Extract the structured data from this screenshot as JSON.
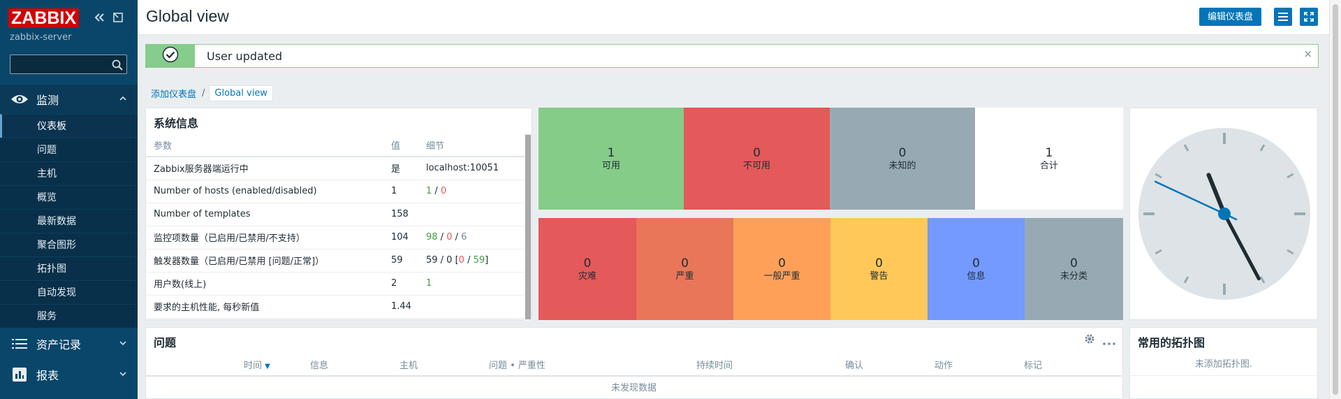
{
  "sidebar": {
    "logo": "ZABBIX",
    "server": "zabbix-server",
    "search_value": "",
    "sections": [
      {
        "label": "监测",
        "icon": "eye-icon",
        "chevron": "^"
      },
      {
        "label": "资产记录",
        "icon": "list-icon",
        "chevron": "v"
      },
      {
        "label": "报表",
        "icon": "chart-icon",
        "chevron": "v"
      }
    ],
    "monitoring_items": [
      {
        "label": "仪表板"
      },
      {
        "label": "问题"
      },
      {
        "label": "主机"
      },
      {
        "label": "概览"
      },
      {
        "label": "最新数据"
      },
      {
        "label": "聚合图形"
      },
      {
        "label": "拓扑图"
      },
      {
        "label": "自动发现"
      },
      {
        "label": "服务"
      }
    ]
  },
  "header": {
    "title": "Global view",
    "edit_label": "编辑仪表盘"
  },
  "message": {
    "text": "User updated",
    "close": "×"
  },
  "breadcrumb": {
    "link": "添加仪表盘",
    "separator": "/",
    "current": "Global view"
  },
  "system_info": {
    "title": "系统信息",
    "headers": {
      "param": "参数",
      "value": "值",
      "details": "细节"
    },
    "rows": [
      {
        "param": "Zabbix服务器端运行中",
        "value": "是",
        "d1": "localhost:10051",
        "d2": "",
        "d3": "",
        "d4": "",
        "d5": "",
        "d6": "",
        "d7": ""
      },
      {
        "param": "Number of hosts (enabled/disabled)",
        "value": "1",
        "d1": "",
        "d2": "1",
        "d3": " / ",
        "d4": "0",
        "d5": "",
        "d6": "",
        "d7": ""
      },
      {
        "param": "Number of templates",
        "value": "158",
        "d1": "",
        "d2": "",
        "d3": "",
        "d4": "",
        "d5": "",
        "d6": "",
        "d7": ""
      },
      {
        "param": "监控项数量（已启用/已禁用/不支持）",
        "value": "104",
        "d1": "",
        "d2": "98",
        "d3": " / ",
        "d4": "0",
        "d5": " / ",
        "d6": "6",
        "d7": ""
      },
      {
        "param": "触发器数量（已启用/已禁用 [问题/正常]）",
        "value": "59",
        "d1": "59 / 0 [",
        "d2": "",
        "d3": "",
        "d4": "0",
        "d5": " / ",
        "d6": "59",
        "d7": "]"
      },
      {
        "param": "用户数(线上)",
        "value": "2",
        "d1": "",
        "d2": "1",
        "d3": "",
        "d4": "",
        "d5": "",
        "d6": "",
        "d7": ""
      },
      {
        "param": "要求的主机性能, 每秒新值",
        "value": "1.44",
        "d1": "",
        "d2": "",
        "d3": "",
        "d4": "",
        "d5": "",
        "d6": "",
        "d7": ""
      }
    ]
  },
  "host_availability": [
    {
      "count": "1",
      "label": "可用",
      "color": "#86cc89"
    },
    {
      "count": "0",
      "label": "不可用",
      "color": "#e45959"
    },
    {
      "count": "0",
      "label": "未知的",
      "color": "#97aab3"
    },
    {
      "count": "1",
      "label": "合计",
      "color": "#ffffff"
    }
  ],
  "problem_severity": [
    {
      "count": "0",
      "label": "灾难",
      "color": "#e45959"
    },
    {
      "count": "0",
      "label": "严重",
      "color": "#e97659"
    },
    {
      "count": "0",
      "label": "一般严重",
      "color": "#ffa059"
    },
    {
      "count": "0",
      "label": "警告",
      "color": "#ffc859"
    },
    {
      "count": "0",
      "label": "信息",
      "color": "#7499ff"
    },
    {
      "count": "0",
      "label": "未分类",
      "color": "#97aab3"
    }
  ],
  "problems": {
    "title": "问题",
    "headers": [
      "时间",
      "信息",
      "主机",
      "问题 • 严重性",
      "持续时间",
      "确认",
      "动作",
      "标记"
    ],
    "sort_arrow": "▼",
    "empty": "未发现数据"
  },
  "favorite_maps": {
    "title": "常用的拓扑图",
    "empty": "未添加拓扑图."
  },
  "clock": {
    "hour_angle": 338,
    "minute_angle": 152,
    "second_angle": 295
  }
}
